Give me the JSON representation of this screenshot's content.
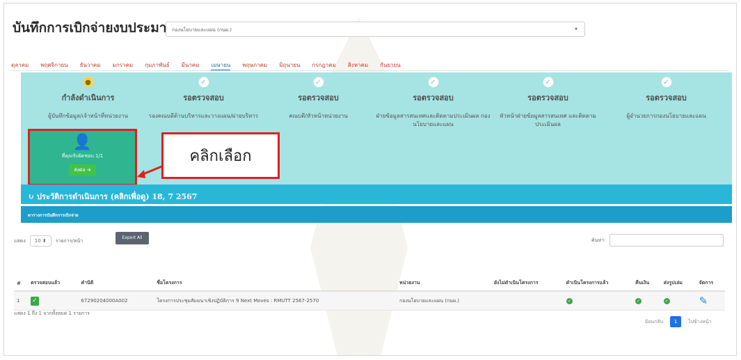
{
  "header": {
    "title": "บันทึกการเบิกจ่ายงบประมาณ",
    "department_select": "กองนโยบายและแผน (กนผ.)"
  },
  "months": [
    {
      "label": "ตุลาคม",
      "active": false
    },
    {
      "label": "พฤศจิกายน",
      "active": false
    },
    {
      "label": "ธันวาคม",
      "active": false
    },
    {
      "label": "มกราคม",
      "active": false
    },
    {
      "label": "กุมภาพันธ์",
      "active": false
    },
    {
      "label": "มีนาคม",
      "active": false
    },
    {
      "label": "เมษายน",
      "active": true
    },
    {
      "label": "พฤษภาคม",
      "active": false
    },
    {
      "label": "มิถุนายน",
      "active": false
    },
    {
      "label": "กรกฎาคม",
      "active": false
    },
    {
      "label": "สิงหาคม",
      "active": false
    },
    {
      "label": "กันยายน",
      "active": false
    }
  ],
  "steps": [
    {
      "status": "กำลังดำเนินการ",
      "description": "ผู้บันทึกข้อมูล/เจ้าหน้าที่หน่วยงาน",
      "current": true
    },
    {
      "status": "รอตรวจสอบ",
      "description": "รองคณบดีด้านบริหารและวางแผน/ผ่ายบริหาร",
      "current": false
    },
    {
      "status": "รอตรวจสอบ",
      "description": "คณบดี/หัวหน้าหน่วยงาน",
      "current": false
    },
    {
      "status": "รอตรวจสอบ",
      "description": "ฝ่ายข้อมูลสารสนเทศและติดตามประเมินผล กองนโยบายและแผน",
      "current": false
    },
    {
      "status": "รอตรวจสอบ",
      "description": "หัวหน้าฝ่ายข้อมูลสารสนเทศ และติดตามประเมินผล",
      "current": false
    },
    {
      "status": "รอตรวจสอบ",
      "description": "ผู้อำนวยการกองนโยบายและแผน",
      "current": false
    }
  ],
  "task_card": {
    "count_label": "ที่คุณรับผิดชอบ 1/1",
    "send_label": "ส่งต่อ ➔"
  },
  "callout": {
    "label": "คลิกเลือก"
  },
  "history": {
    "title": "ประวัติการดำเนินการ (คลิกเพื่อดู) 18, 7 2567",
    "table_title": "ตารางการบันทึกการเบิกจ่าย"
  },
  "controls": {
    "show_label": "แสดง",
    "page_size": "10",
    "per_page_label": "รายการ/หน้า",
    "export_label": "Export All",
    "search_label": "ค้นหา:"
  },
  "table": {
    "headers": [
      "#",
      "ตรวจสอบแล้ว",
      "คำนิดิ",
      "ชื่อโครงการ",
      "หน่วยงาน",
      "ยังไม่ดำเนินโครงการ",
      "ดำเนินโครงการแล้ว",
      "คืนเงิน",
      "ส่งรูปเล่ม",
      "จัดการ"
    ],
    "rows": [
      {
        "index": "1",
        "code": "67290204000A002",
        "project": "โครงการประชุมสัมมนาเชิงปฏิบัติการ 9 Next Moves : RMUTT 2567-2570",
        "department": "กองนโยบายและแผน (กนผ.)"
      }
    ]
  },
  "footer": {
    "info": "แสดง 1 ถึง 1 จากทั้งหมด 1 รายการ",
    "prev": "ย้อนกลับ",
    "page": "1",
    "next": "ไปข้างหน้า"
  }
}
